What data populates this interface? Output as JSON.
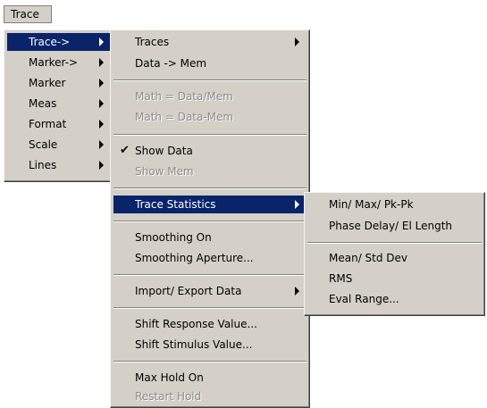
{
  "menubar": {
    "trace_label": "Trace"
  },
  "menu1": {
    "items": [
      "Trace->",
      "Marker->",
      "Marker",
      "Meas",
      "Format",
      "Scale",
      "Lines"
    ]
  },
  "menu2": {
    "traces": "Traces",
    "data_to_mem": "Data -> Mem",
    "math_data_div_mem": "Math = Data/Mem",
    "math_data_minus_mem": "Math = Data-Mem",
    "show_data": "Show Data",
    "show_data_check": "✔",
    "show_mem": "Show Mem",
    "trace_statistics": "Trace Statistics",
    "smoothing_on": "Smoothing On",
    "smoothing_aperture": "Smoothing Aperture...",
    "import_export": "Import/ Export Data",
    "shift_response": "Shift Response Value...",
    "shift_stimulus": "Shift Stimulus Value...",
    "max_hold_on": "Max Hold On",
    "restart_hold": "Restart Hold"
  },
  "menu3": {
    "min_max_pkpk": "Min/ Max/ Pk-Pk",
    "phase_delay": "Phase Delay/ El Length",
    "mean_std_dev": "Mean/ Std Dev",
    "rms": "RMS",
    "eval_range": "Eval Range..."
  }
}
